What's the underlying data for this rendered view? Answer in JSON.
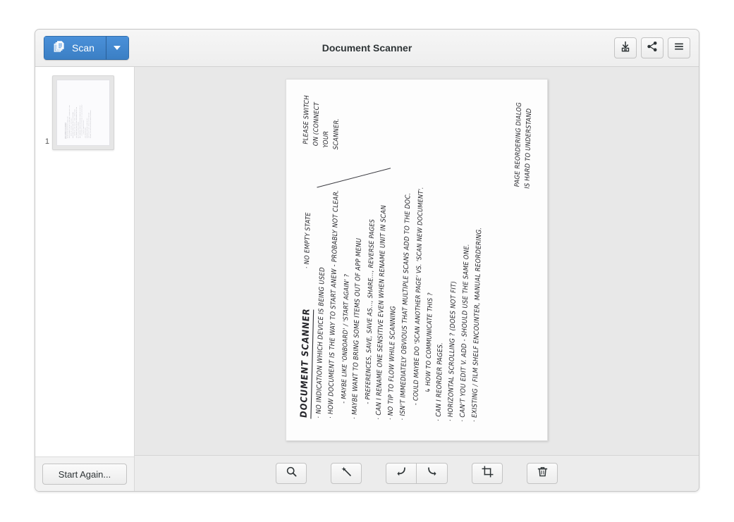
{
  "window": {
    "title": "Document Scanner"
  },
  "header": {
    "scan_label": "Scan",
    "scan_icon": "documents-stack-icon",
    "dropdown_icon": "chevron-down-icon",
    "buttons": [
      {
        "name": "save-button",
        "icon": "save-download-icon",
        "tooltip": "Save"
      },
      {
        "name": "share-button",
        "icon": "share-icon",
        "tooltip": "Share"
      },
      {
        "name": "menu-button",
        "icon": "hamburger-menu-icon",
        "tooltip": "Menu"
      }
    ]
  },
  "sidebar": {
    "pages": [
      {
        "number": "1",
        "label": "Page 1 thumbnail"
      }
    ],
    "start_again_label": "Start Again..."
  },
  "toolbar": {
    "buttons": [
      {
        "name": "zoom-button",
        "icon": "magnifier-icon",
        "label": "Zoom"
      },
      {
        "name": "magic-wand-button",
        "icon": "magic-wand-icon",
        "label": "Enhance"
      },
      {
        "name": "rotate-left-button",
        "icon": "rotate-left-icon",
        "label": "Rotate Left"
      },
      {
        "name": "rotate-right-button",
        "icon": "rotate-right-icon",
        "label": "Rotate Right"
      },
      {
        "name": "crop-button",
        "icon": "crop-icon",
        "label": "Crop"
      },
      {
        "name": "delete-button",
        "icon": "trash-icon",
        "label": "Delete"
      }
    ]
  },
  "document": {
    "page_count": 1,
    "handwriting": {
      "title": "DOCUMENT SCANNER",
      "note_empty_state": "· NO EMPTY STATE",
      "note_top_right": "PLEASE SWITCH\nON (CONNECT\nYOUR\nSCANNER.",
      "note_bottom_right": "PAGE REORDERING DIALOG\nIS HARD TO UNDERSTAND",
      "lines": [
        {
          "indent": 0,
          "text": "· NO INDICATION WHICH DEVICE IS BEING USED"
        },
        {
          "indent": 0,
          "text": "· HOW DOCUMENT IS THE WAY TO START ANEW - PROBABLY NOT CLEAR."
        },
        {
          "indent": 1,
          "text": "- MAYBE LIKE 'ONBOARD' / 'START AGAIN' ?"
        },
        {
          "indent": 0,
          "text": "· MAYBE WANT TO BRING SOME ITEMS OUT OF APP MENU"
        },
        {
          "indent": 1,
          "text": "- PREFERENCES, SAVE, SAVE AS..., SHARE..., REVERSE PAGES"
        },
        {
          "indent": 0,
          "text": "· CAN I RENAME ONE SENSITIVE EVEN WHEN RENAME UNIT IN SCAN"
        },
        {
          "indent": 0,
          "text": "· NO TIP TO FLOW WHILE SCANNING"
        },
        {
          "indent": 0,
          "text": "· ISN'T IMMEDIATELY OBVIOUS THAT MULTIPLE SCANS ADD TO THE DOC."
        },
        {
          "indent": 1,
          "text": "- COULD MAYBE DO 'SCAN ANOTHER PAGE' VS. 'SCAN NEW DOCUMENT'."
        },
        {
          "indent": 2,
          "text": "↳ HOW TO COMMUNICATE THIS ?"
        },
        {
          "indent": 0,
          "text": "· CAN I REORDER PAGES."
        },
        {
          "indent": 0,
          "text": "· HORIZONTAL SCROLLING ? (DOES NOT FIT)"
        },
        {
          "indent": 0,
          "text": "· CAN'T YOU EDIT V. ADD - SHOULD USE THE SAME ONE."
        },
        {
          "indent": 0,
          "text": "· EXISTING / FILM SHELF ENCOUNTER, MANUAL REORDERING."
        }
      ]
    }
  },
  "colors": {
    "accent": "#3b7fc4",
    "header_bg": "#f0f0f0",
    "viewer_bg": "#e8e8e8",
    "sidebar_bg": "#ffffff",
    "ink": "#26262b"
  }
}
